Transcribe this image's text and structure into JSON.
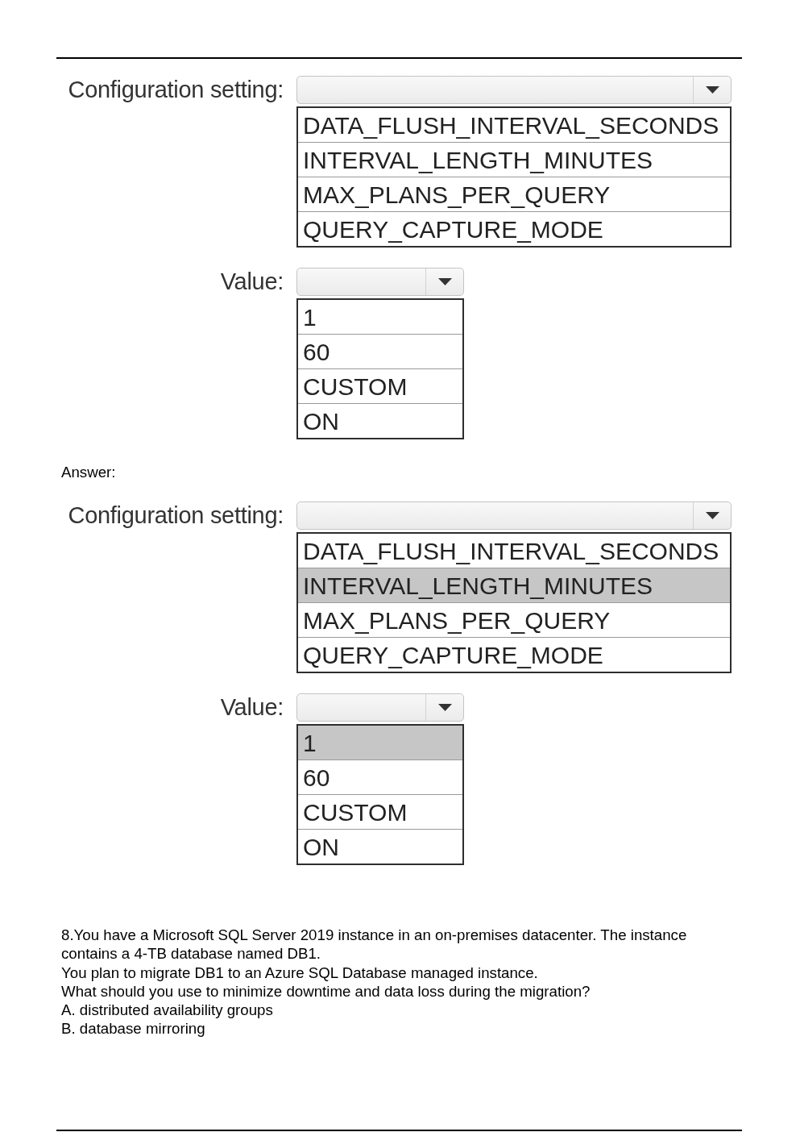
{
  "hotspot": {
    "fields": [
      {
        "label": "Configuration setting:",
        "options": [
          {
            "text": "DATA_FLUSH_INTERVAL_SECONDS",
            "selected": false
          },
          {
            "text": "INTERVAL_LENGTH_MINUTES",
            "selected": false
          },
          {
            "text": "MAX_PLANS_PER_QUERY",
            "selected": false
          },
          {
            "text": "QUERY_CAPTURE_MODE",
            "selected": false
          }
        ]
      },
      {
        "label": "Value:",
        "options": [
          {
            "text": "1",
            "selected": false
          },
          {
            "text": "60",
            "selected": false
          },
          {
            "text": "CUSTOM",
            "selected": false
          },
          {
            "text": "ON",
            "selected": false
          }
        ]
      }
    ]
  },
  "answer": {
    "label": "Answer:",
    "fields": [
      {
        "label": "Configuration setting:",
        "options": [
          {
            "text": "DATA_FLUSH_INTERVAL_SECONDS",
            "selected": false
          },
          {
            "text": "INTERVAL_LENGTH_MINUTES",
            "selected": true
          },
          {
            "text": "MAX_PLANS_PER_QUERY",
            "selected": false
          },
          {
            "text": "QUERY_CAPTURE_MODE",
            "selected": false
          }
        ]
      },
      {
        "label": "Value:",
        "options": [
          {
            "text": "1",
            "selected": true
          },
          {
            "text": "60",
            "selected": false
          },
          {
            "text": "CUSTOM",
            "selected": false
          },
          {
            "text": "ON",
            "selected": false
          }
        ]
      }
    ]
  },
  "next_question": {
    "lines": [
      "8.You have a Microsoft SQL Server 2019 instance in an on-premises datacenter. The instance contains a 4-TB database named DB1.",
      "You plan to migrate DB1 to an Azure SQL Database managed instance.",
      "What should you use to minimize downtime and data loss during the migration?"
    ],
    "choices": [
      "A. distributed availability groups",
      "B. database mirroring"
    ]
  }
}
